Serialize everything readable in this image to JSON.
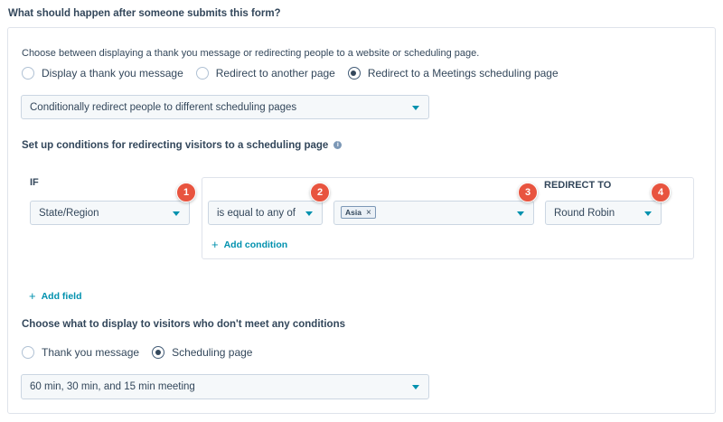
{
  "page": {
    "question": "What should happen after someone submits this form?"
  },
  "submit_action": {
    "description": "Choose between displaying a thank you message or redirecting people to a website or scheduling page.",
    "options": [
      {
        "label": "Display a thank you message",
        "selected": false
      },
      {
        "label": "Redirect to another page",
        "selected": false
      },
      {
        "label": "Redirect to a Meetings scheduling page",
        "selected": true
      }
    ],
    "mode_select": "Conditionally redirect people to different scheduling pages"
  },
  "conditions": {
    "title": "Set up conditions for redirecting visitors to a scheduling page",
    "info_icon": "info-icon",
    "if_label": "IF",
    "redirect_label": "REDIRECT TO",
    "property_select": "State/Region",
    "operator_select": "is equal to any of",
    "value_tag": "Asia",
    "value_tag_remove": "×",
    "redirect_select": "Round Robin",
    "add_condition": "Add condition",
    "add_field": "Add field",
    "add_icon": "+",
    "badges": [
      "1",
      "2",
      "3",
      "4"
    ],
    "badge_color": "#e8543f"
  },
  "fallback": {
    "title": "Choose what to display to visitors who don't meet any conditions",
    "options": [
      {
        "label": "Thank you message",
        "selected": false
      },
      {
        "label": "Scheduling page",
        "selected": true
      }
    ],
    "select": "60 min, 30 min, and 15 min meeting"
  },
  "colors": {
    "accent": "#0091ae",
    "text": "#33475b",
    "border": "#cbd6e2"
  }
}
